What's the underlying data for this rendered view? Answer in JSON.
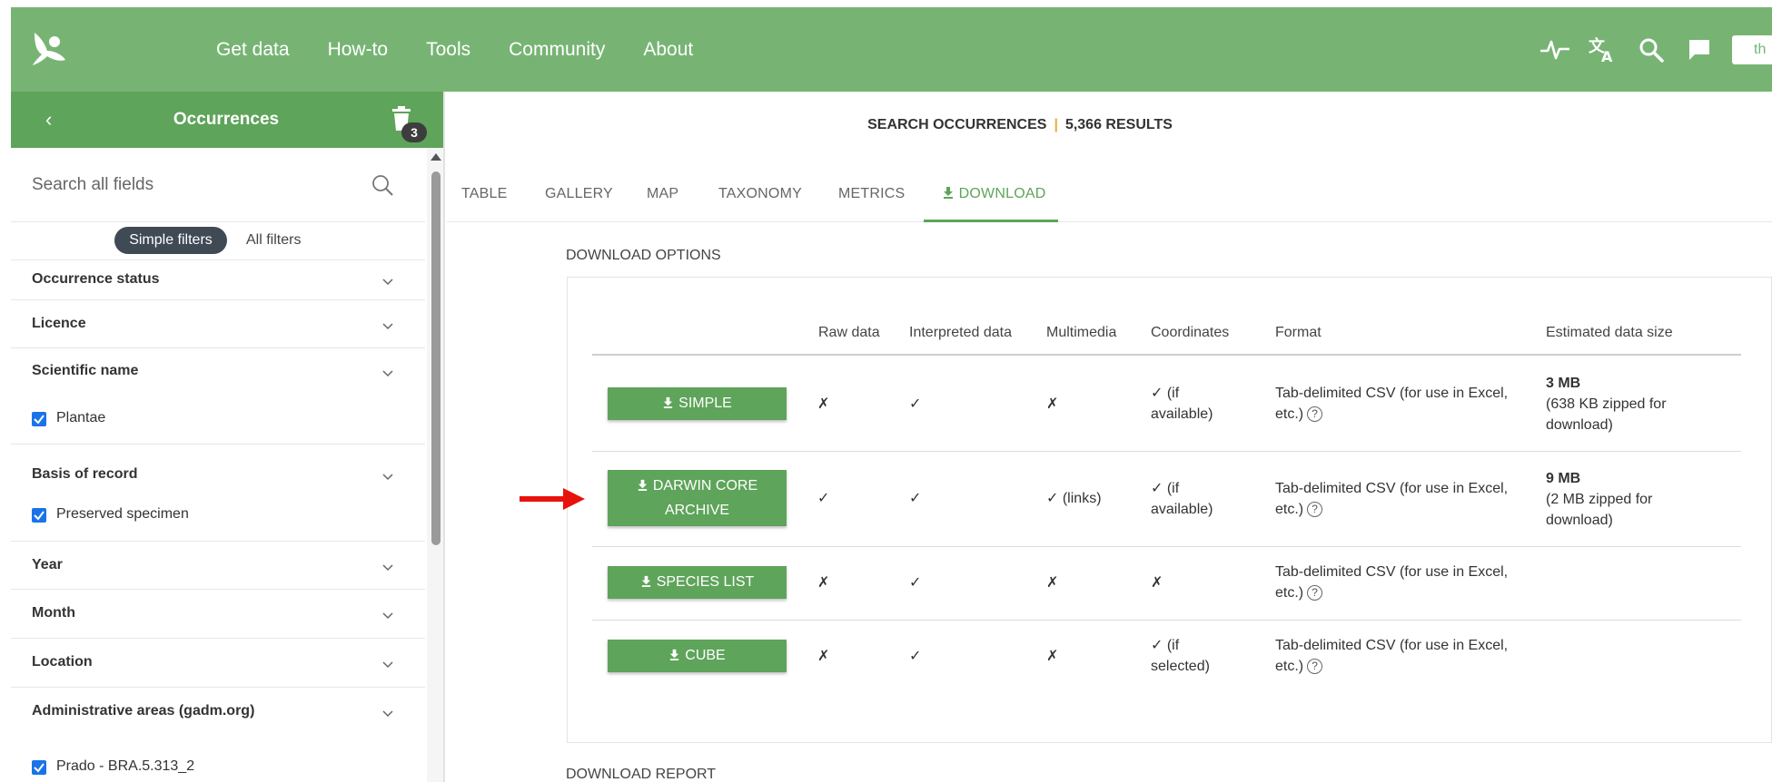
{
  "nav": {
    "items": [
      "Get data",
      "How-to",
      "Tools",
      "Community",
      "About"
    ],
    "lang_box_text": "th",
    "icons": [
      "pulse-icon",
      "translate-icon",
      "search-icon",
      "feedback-icon"
    ]
  },
  "sidebar": {
    "title": "Occurrences",
    "back_icon": "‹",
    "trash_count": "3",
    "search_placeholder": "Search all fields",
    "simple_filters": "Simple filters",
    "all_filters": "All filters",
    "filters": [
      {
        "label": "Occurrence status"
      },
      {
        "label": "Licence"
      },
      {
        "label": "Scientific name",
        "checked": "Plantae"
      },
      {
        "label": "Basis of record",
        "checked": "Preserved specimen"
      },
      {
        "label": "Year"
      },
      {
        "label": "Month"
      },
      {
        "label": "Location"
      },
      {
        "label": "Administrative areas (gadm.org)",
        "checked": "Prado - BRA.5.313_2"
      }
    ]
  },
  "main": {
    "search_title": "SEARCH OCCURRENCES",
    "results": "5,366 RESULTS",
    "tabs": [
      "TABLE",
      "GALLERY",
      "MAP",
      "TAXONOMY",
      "METRICS",
      "DOWNLOAD"
    ],
    "active_tab": "DOWNLOAD",
    "download_options": "DOWNLOAD OPTIONS",
    "download_report": "DOWNLOAD REPORT",
    "table": {
      "headers": [
        "Raw data",
        "Interpreted data",
        "Multimedia",
        "Coordinates",
        "Format",
        "Estimated data size"
      ],
      "rows": [
        {
          "button": "SIMPLE",
          "raw": "✗",
          "interpreted": "✓",
          "multimedia": "✗",
          "coordinates": "✓ (if available)",
          "format": "Tab-delimited CSV (for use in Excel, etc.)",
          "size_main": "3 MB",
          "size_sub": "(638 KB zipped for download)"
        },
        {
          "button": "DARWIN CORE ARCHIVE",
          "raw": "✓",
          "interpreted": "✓",
          "multimedia": "✓ (links)",
          "coordinates": "✓ (if available)",
          "format": "Tab-delimited CSV (for use in Excel, etc.)",
          "size_main": "9 MB",
          "size_sub": "(2 MB zipped for download)"
        },
        {
          "button": "SPECIES LIST",
          "raw": "✗",
          "interpreted": "✓",
          "multimedia": "✗",
          "coordinates": "✗",
          "format": "Tab-delimited CSV (for use in Excel, etc.)",
          "size_main": "",
          "size_sub": ""
        },
        {
          "button": "CUBE",
          "raw": "✗",
          "interpreted": "✓",
          "multimedia": "✗",
          "coordinates": "✓ (if selected)",
          "format": "Tab-delimited CSV (for use in Excel, etc.)",
          "size_main": "",
          "size_sub": ""
        }
      ]
    }
  },
  "colors": {
    "brand_green": "#77b474",
    "button_green": "#5ea45a",
    "results_separator": "#e5b23c",
    "arrow_red": "#e8120c"
  }
}
